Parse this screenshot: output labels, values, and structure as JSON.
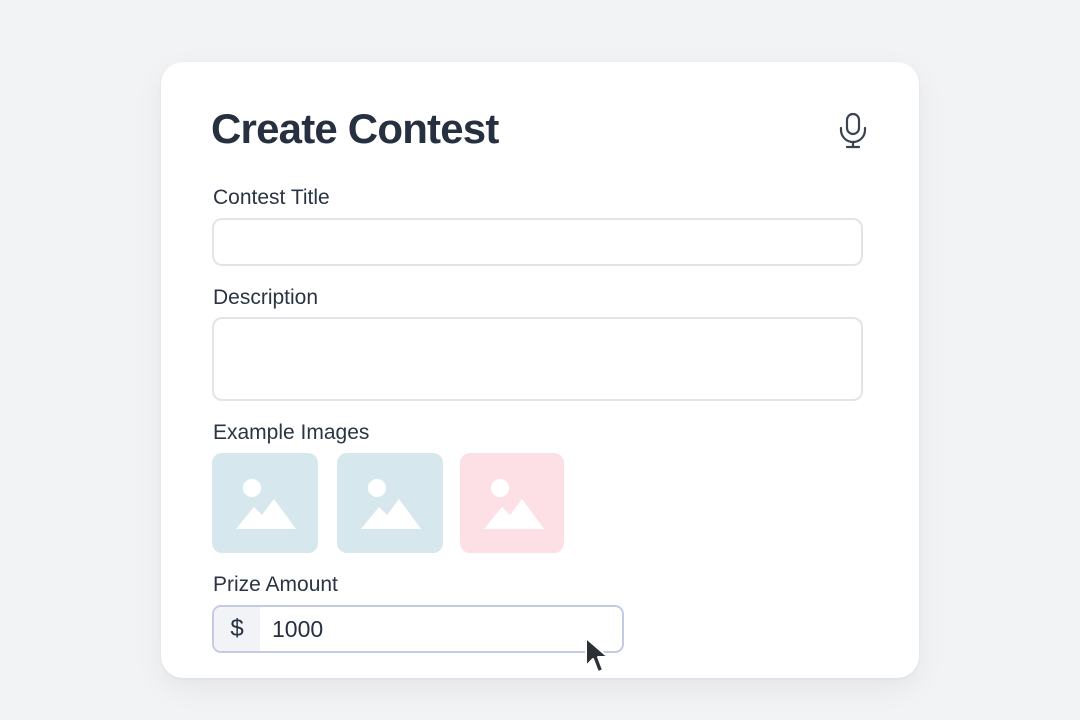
{
  "form": {
    "title": "Create Contest",
    "mic_icon": "microphone-icon",
    "fields": {
      "contest_title": {
        "label": "Contest Title",
        "value": "",
        "placeholder": ""
      },
      "description": {
        "label": "Description",
        "value": "",
        "placeholder": ""
      },
      "example_images": {
        "label": "Example Images",
        "images": [
          {
            "icon": "image-placeholder-icon",
            "color": "#d6e8ee"
          },
          {
            "icon": "image-placeholder-icon",
            "color": "#d6e8ee"
          },
          {
            "icon": "image-placeholder-icon",
            "color": "#fde0e5"
          }
        ]
      },
      "prize_amount": {
        "label": "Prize Amount",
        "currency": "$",
        "value": "1000"
      }
    }
  },
  "cursor_icon": "mouse-pointer-icon"
}
